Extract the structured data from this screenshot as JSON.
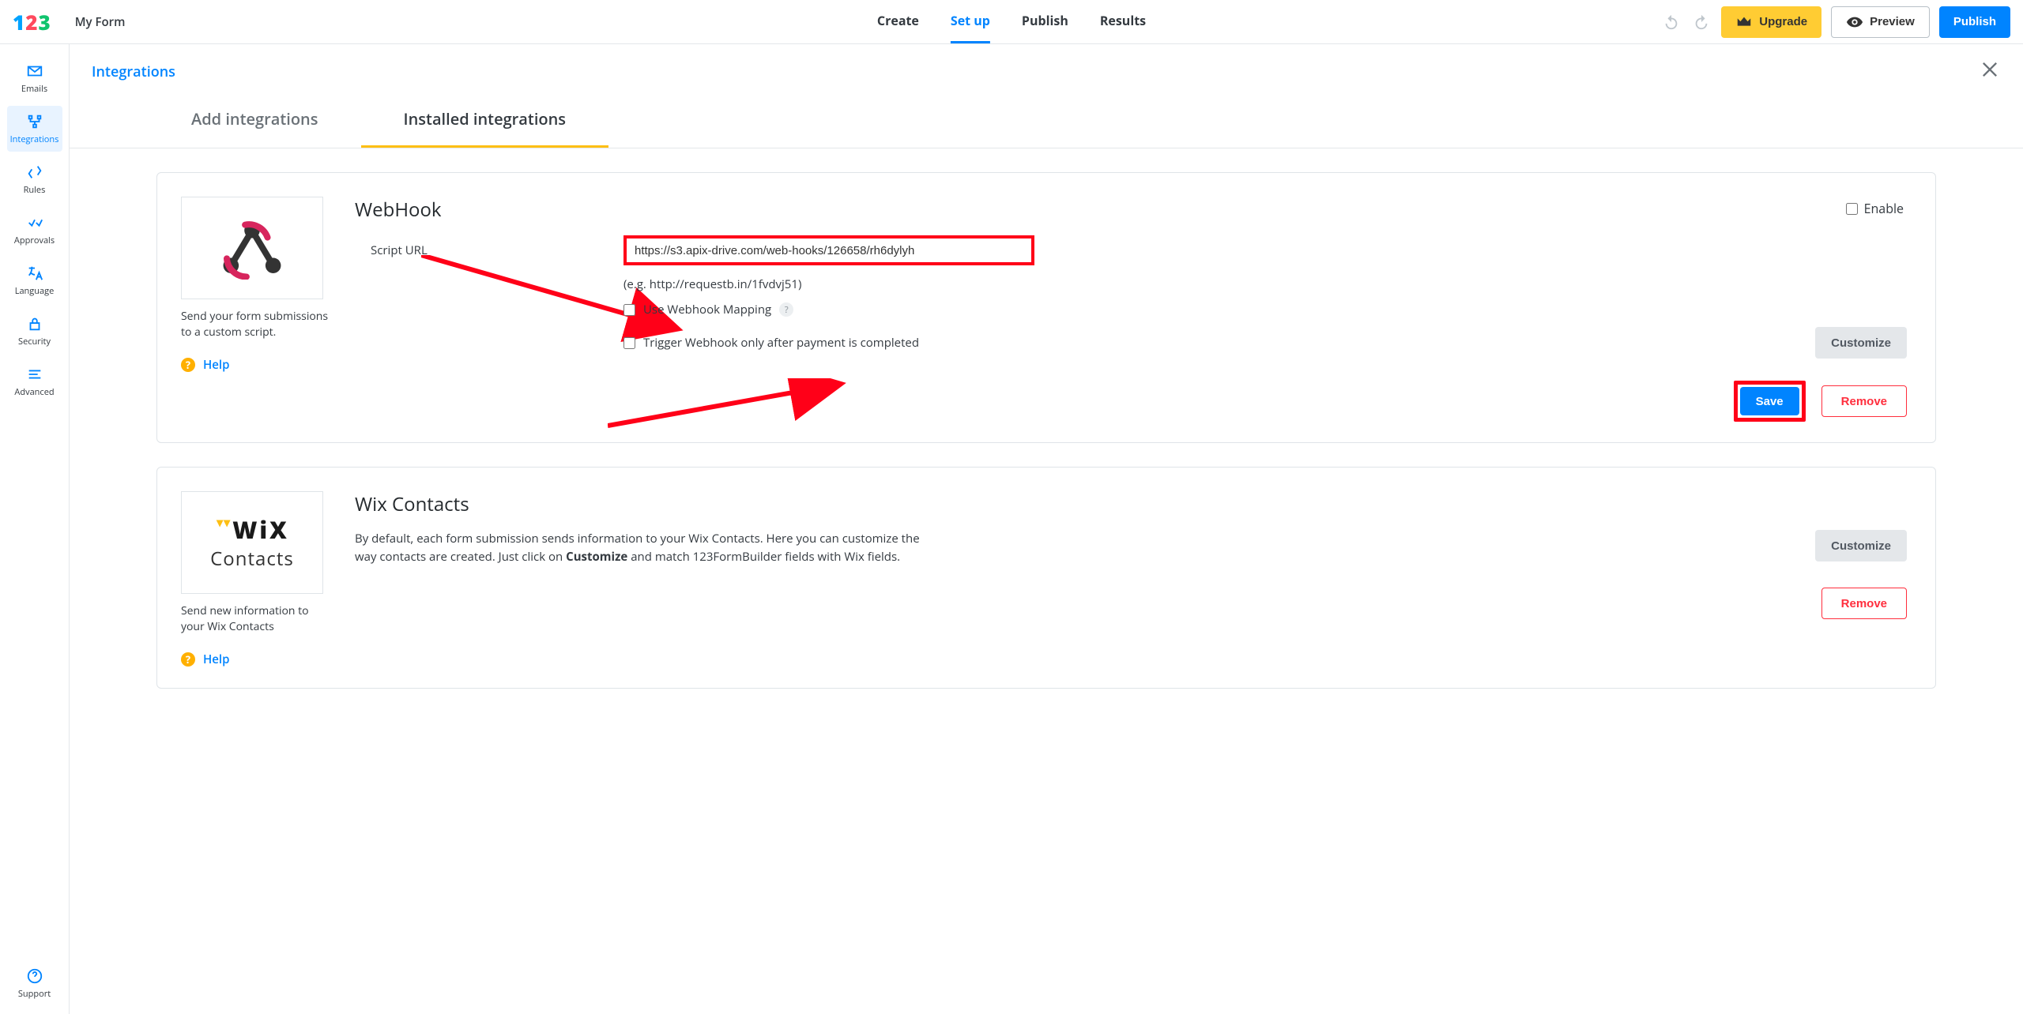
{
  "header": {
    "form_title": "My Form",
    "tabs": [
      "Create",
      "Set up",
      "Publish",
      "Results"
    ],
    "active_tab": 1,
    "upgrade": "Upgrade",
    "preview": "Preview",
    "publish": "Publish"
  },
  "sidebar": {
    "items": [
      {
        "label": "Emails"
      },
      {
        "label": "Integrations"
      },
      {
        "label": "Rules"
      },
      {
        "label": "Approvals"
      },
      {
        "label": "Language"
      },
      {
        "label": "Security"
      },
      {
        "label": "Advanced"
      }
    ],
    "support": "Support"
  },
  "page": {
    "title": "Integrations",
    "subtabs": {
      "add": "Add integrations",
      "installed": "Installed integrations"
    }
  },
  "webhook": {
    "title": "WebHook",
    "desc": "Send your form submissions to a custom script.",
    "help": "Help",
    "enable": "Enable",
    "script_label": "Script URL",
    "script_value": "https://s3.apix-drive.com/web-hooks/126658/rh6dylyh",
    "hint": "(e.g. http://requestb.in/1fvdvj51)",
    "use_mapping": "Use Webhook Mapping",
    "trigger_after_payment": "Trigger Webhook only after payment is completed",
    "customize": "Customize",
    "save": "Save",
    "remove": "Remove"
  },
  "wix": {
    "title": "Wix Contacts",
    "desc_pre": "By default, each form submission sends information to your Wix Contacts. Here you can customize the way contacts are created. Just click on ",
    "desc_bold": "Customize",
    "desc_post": " and match 123FormBuilder fields with Wix fields.",
    "left_desc": "Send new information to your Wix Contacts",
    "help": "Help",
    "customize": "Customize",
    "remove": "Remove"
  }
}
